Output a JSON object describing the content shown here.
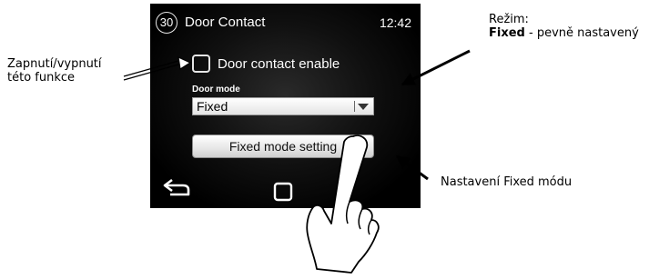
{
  "screen": {
    "number": "30",
    "title": "Door Contact",
    "clock": "12:42",
    "checkbox": {
      "label": "Door contact enable",
      "checked": false
    },
    "door_mode": {
      "label": "Door mode",
      "selected": "Fixed"
    },
    "mode_button_label": "Fixed mode setting",
    "nav": {
      "back_icon": "back-arrow-icon",
      "home_icon": "home-square-icon"
    }
  },
  "annotations": {
    "left_line1": "Zapnutí/vypnutí",
    "left_line2": "této funkce",
    "top_right_line1": "Režim:",
    "top_right_bold": "Fixed",
    "top_right_rest": " - pevně nastavený",
    "bottom_right": "Nastavení Fixed módu"
  },
  "overlay": {
    "hand_icon": "pointing-hand-icon"
  },
  "colors": {
    "screen_bg": "#000000",
    "button_bg": "#e6e6e6",
    "annotation_text": "#000000"
  }
}
